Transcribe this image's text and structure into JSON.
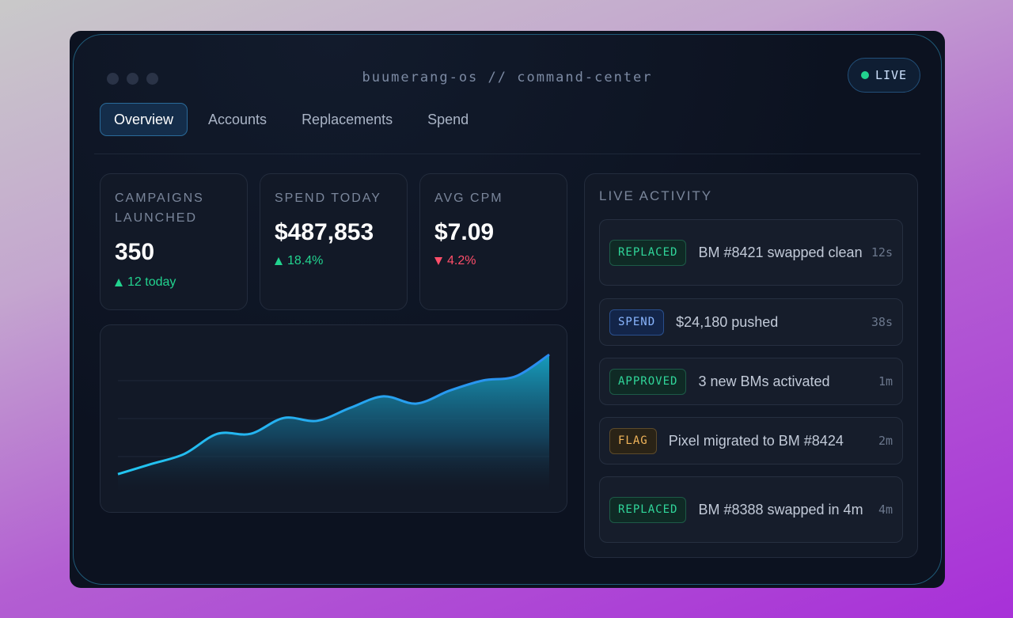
{
  "window": {
    "title": "buumerang-os // command-center",
    "live_label": "LIVE"
  },
  "tabs": [
    {
      "label": "Overview",
      "active": true
    },
    {
      "label": "Accounts",
      "active": false
    },
    {
      "label": "Replacements",
      "active": false
    },
    {
      "label": "Spend",
      "active": false
    }
  ],
  "stats": [
    {
      "label": "CAMPAIGNS LAUNCHED",
      "value": "350",
      "delta": "12 today",
      "direction": "up"
    },
    {
      "label": "SPEND TODAY",
      "value": "$487,853",
      "delta": "18.4%",
      "direction": "up"
    },
    {
      "label": "AVG CPM",
      "value": "$7.09",
      "delta": "4.2%",
      "direction": "down"
    }
  ],
  "activity": {
    "title": "LIVE ACTIVITY",
    "items": [
      {
        "badge": "REPLACED",
        "kind": "green",
        "text": "BM #8421 swapped clean",
        "time": "12s"
      },
      {
        "badge": "SPEND",
        "kind": "blue",
        "text": "$24,180 pushed",
        "time": "38s"
      },
      {
        "badge": "APPROVED",
        "kind": "green",
        "text": "3 new BMs activated",
        "time": "1m"
      },
      {
        "badge": "FLAG",
        "kind": "amber",
        "text": "Pixel migrated to BM #8424",
        "time": "2m"
      },
      {
        "badge": "REPLACED",
        "kind": "green",
        "text": "BM #8388 swapped in 4m",
        "time": "4m"
      }
    ]
  },
  "colors": {
    "accent": "#22b8e8",
    "up": "#22d38f",
    "down": "#ff4e6a",
    "live": "#22d38f"
  },
  "chart_data": {
    "type": "area",
    "x": [
      0,
      1,
      2,
      3,
      4,
      5,
      6,
      7,
      8,
      9,
      10,
      11,
      12,
      13
    ],
    "values": [
      12,
      19,
      26,
      40,
      40,
      51,
      49,
      58,
      66,
      61,
      70,
      77,
      80,
      95
    ],
    "ylim": [
      0,
      100
    ],
    "grid": true,
    "title": "",
    "xlabel": "",
    "ylabel": ""
  }
}
